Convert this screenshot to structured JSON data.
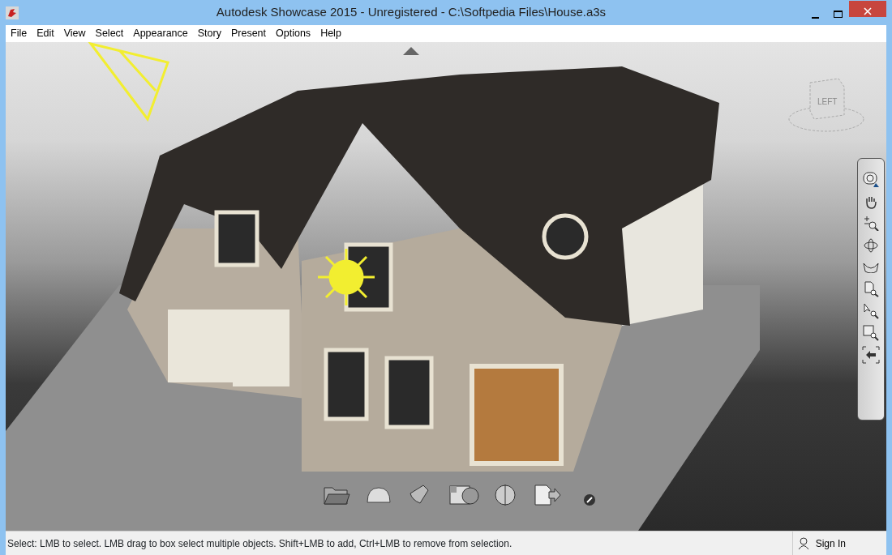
{
  "window": {
    "title": "Autodesk Showcase 2015 - Unregistered - C:\\Softpedia Files\\House.a3s"
  },
  "menu": [
    "File",
    "Edit",
    "View",
    "Select",
    "Appearance",
    "Story",
    "Present",
    "Options",
    "Help"
  ],
  "viewport": {
    "viewcube_label": "LEFT"
  },
  "status_bar": {
    "message": "Select: LMB to select. LMB drag to box select multiple objects. Shift+LMB to add, Ctrl+LMB to remove from selection.",
    "sign_in": "Sign In"
  }
}
